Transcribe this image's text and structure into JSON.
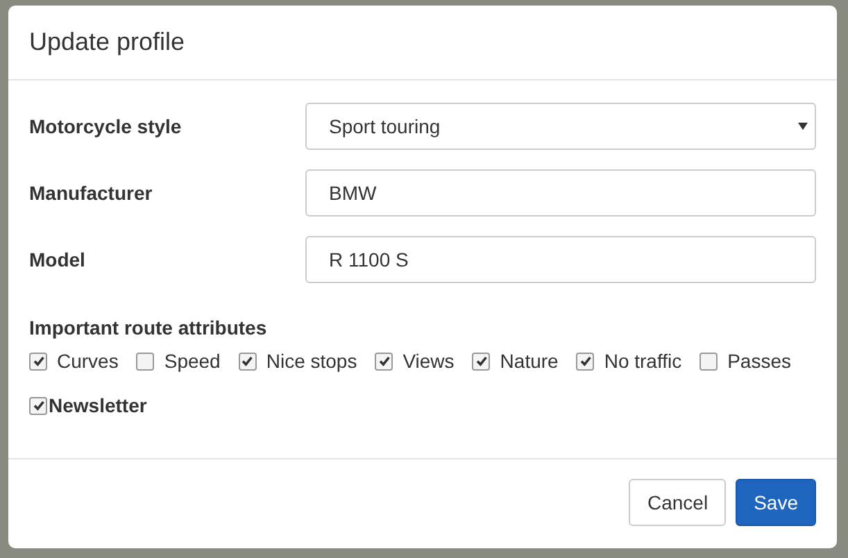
{
  "dialog": {
    "title": "Update profile"
  },
  "fields": [
    {
      "kind": "select",
      "label": "Motorcycle style",
      "value": "Sport touring"
    },
    {
      "kind": "text",
      "label": "Manufacturer",
      "value": "BMW"
    },
    {
      "kind": "text",
      "label": "Model",
      "value": "R 1100 S"
    }
  ],
  "route_attributes": {
    "label": "Important route attributes",
    "options": [
      {
        "label": "Curves",
        "checked": true
      },
      {
        "label": "Speed",
        "checked": false
      },
      {
        "label": "Nice stops",
        "checked": true
      },
      {
        "label": "Views",
        "checked": true
      },
      {
        "label": "Nature",
        "checked": true
      },
      {
        "label": "No traffic",
        "checked": true
      },
      {
        "label": "Passes",
        "checked": false
      }
    ]
  },
  "newsletter": {
    "label": "Newsletter",
    "checked": true
  },
  "buttons": [
    {
      "label": "Cancel",
      "kind": "default"
    },
    {
      "label": "Save",
      "kind": "primary"
    }
  ]
}
